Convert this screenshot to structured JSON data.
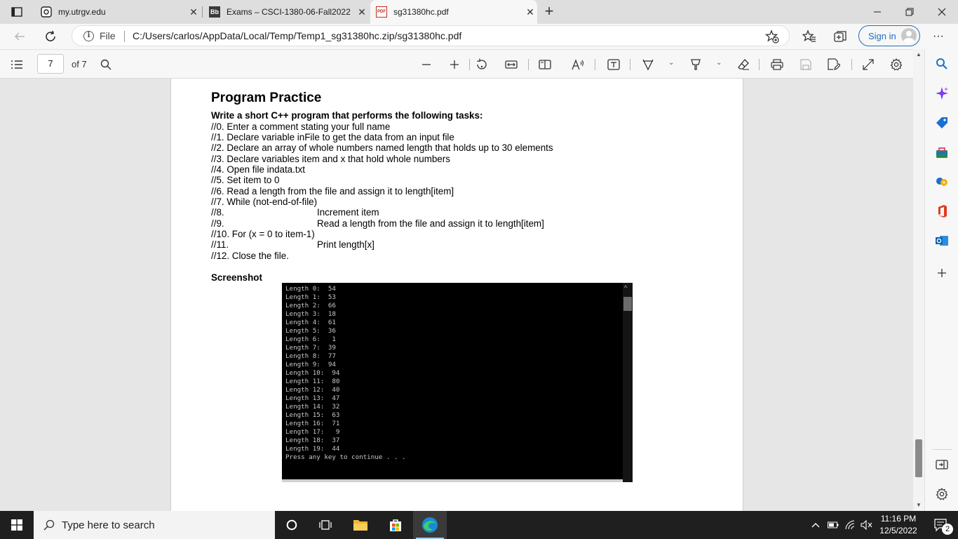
{
  "browser": {
    "tabs": [
      {
        "title": "my.utrgv.edu",
        "favicon": "utrgv-icon"
      },
      {
        "title": "Exams – CSCI-1380-06-Fall2022",
        "favicon": "blackboard-icon",
        "favicon_text": "Bb"
      },
      {
        "title": "sg31380hc.pdf",
        "favicon": "pdf-icon",
        "favicon_text": "PDF",
        "active": true
      }
    ],
    "address": {
      "prefix": "File",
      "url": "C:/Users/carlos/AppData/Local/Temp/Temp1_sg31380hc.zip/sg31380hc.pdf"
    },
    "signin_label": "Sign in"
  },
  "pdf_toolbar": {
    "page_current": "7",
    "page_total_label": "of 7"
  },
  "document": {
    "title": "Program Practice",
    "instructions": "Write a short C++ program that performs the following tasks:",
    "steps": [
      {
        "text": "//0. Enter a comment stating your full name"
      },
      {
        "text": "//1. Declare variable inFile to get the data from an input file"
      },
      {
        "text": "//2. Declare an array of whole numbers named length that holds up to 30 elements"
      },
      {
        "text": "//3. Declare variables item and x that hold whole numbers"
      },
      {
        "text": "//4. Open file indata.txt"
      },
      {
        "text": "//5. Set item to 0"
      },
      {
        "text": "//6. Read a length from the file and assign it to length[item]"
      },
      {
        "text": "//7. While (not-end-of-file)"
      },
      {
        "text": "//8.",
        "indented": "Increment item"
      },
      {
        "text": "//9.",
        "indented": "Read a length from the file and assign it to length[item]"
      },
      {
        "text": "//10. For (x = 0 to item-1)"
      },
      {
        "text": "//11.",
        "indented": "Print length[x]"
      },
      {
        "text": "//12. Close the file."
      }
    ],
    "screenshot_label": "Screenshot",
    "console_lines": [
      "Length 0:  54",
      "Length 1:  53",
      "Length 2:  66",
      "Length 3:  18",
      "Length 4:  61",
      "Length 5:  36",
      "Length 6:   1",
      "Length 7:  39",
      "Length 8:  77",
      "Length 9:  94",
      "Length 10:  94",
      "Length 11:  80",
      "Length 12:  40",
      "Length 13:  47",
      "Length 14:  32",
      "Length 15:  63",
      "Length 16:  71",
      "Length 17:   9",
      "Length 18:  37",
      "Length 19:  44",
      "Press any key to continue . . ."
    ]
  },
  "sidebar": {
    "items": [
      "search-icon",
      "copilot-icon",
      "shopping-icon",
      "tools-icon",
      "games-icon",
      "office-icon",
      "outlook-icon",
      "add-icon"
    ]
  },
  "taskbar": {
    "search_placeholder": "Type here to search",
    "time": "11:16 PM",
    "date": "12/5/2022",
    "notification_count": "2"
  }
}
